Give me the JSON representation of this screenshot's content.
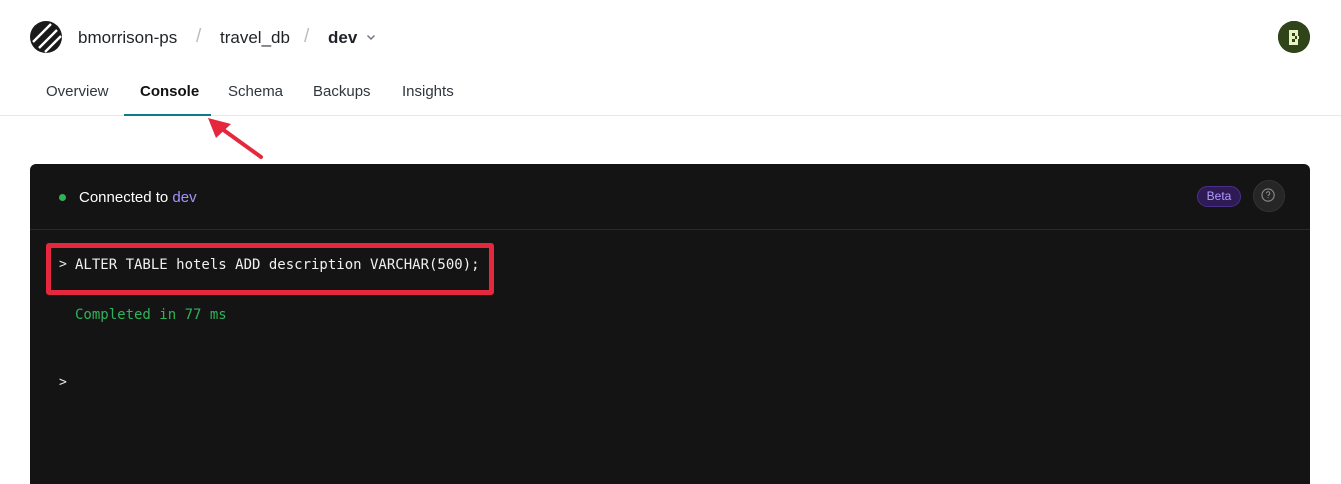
{
  "breadcrumb": {
    "org": "bmorrison-ps",
    "separator": "/",
    "database": "travel_db",
    "branch": "dev"
  },
  "tabs": [
    {
      "label": "Overview"
    },
    {
      "label": "Console",
      "active": true
    },
    {
      "label": "Schema"
    },
    {
      "label": "Backups"
    },
    {
      "label": "Insights"
    }
  ],
  "console": {
    "status_prefix": "Connected to",
    "status_branch": "dev",
    "badge": "Beta",
    "prompt_symbol": ">",
    "command": "ALTER TABLE hotels ADD description VARCHAR(500);",
    "result": "Completed in 77 ms"
  },
  "icons": {
    "logo": "planetscale-logo",
    "branch_dropdown": "chevron-down-icon",
    "help": "help-circle-icon",
    "avatar": "user-avatar"
  },
  "colors": {
    "accent_underline": "#0e7c86",
    "console_bg": "#141414",
    "status_dot": "#2fb35a",
    "branch_highlight": "#a591ff",
    "result_text": "#2fb35a",
    "annotation": "#e5283d"
  }
}
